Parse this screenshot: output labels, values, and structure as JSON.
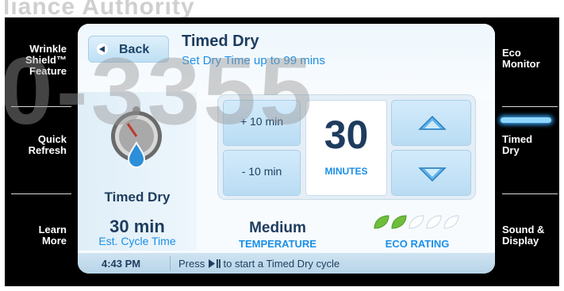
{
  "watermark": {
    "top_text": "liance Authority",
    "big_text": "0-3355"
  },
  "left_nav": [
    {
      "label": "Wrinkle Shield™ Feature"
    },
    {
      "label": "Quick Refresh"
    },
    {
      "label": "Learn More"
    }
  ],
  "right_nav": [
    {
      "label": "Eco Monitor"
    },
    {
      "label": "Timed Dry",
      "selected": true
    },
    {
      "label": "Sound & Display"
    }
  ],
  "header": {
    "back_label": "Back",
    "title": "Timed Dry",
    "subtitle": "Set Dry Time up to 99 mins"
  },
  "cycle": {
    "icon": "timed-dry-icon",
    "name": "Timed Dry",
    "time": "30 min",
    "time_caption": "Est. Cycle Time"
  },
  "timer": {
    "plus_label": "+ 10 min",
    "minus_label": "- 10 min",
    "value": "30",
    "unit": "MINUTES",
    "up_icon": "arrow-up-icon",
    "down_icon": "arrow-down-icon"
  },
  "temperature": {
    "value": "Medium",
    "caption": "TEMPERATURE"
  },
  "eco": {
    "caption": "ECO RATING",
    "rating": 2,
    "max": 5
  },
  "status": {
    "time": "4:43 PM",
    "message_pre": "Press",
    "message_post": "to start a Timed Dry cycle",
    "icon": "play-pause-icon"
  },
  "colors": {
    "accent": "#1b8fe6",
    "dark": "#1d3c5e",
    "leaf_on": "#6fbe3b"
  }
}
